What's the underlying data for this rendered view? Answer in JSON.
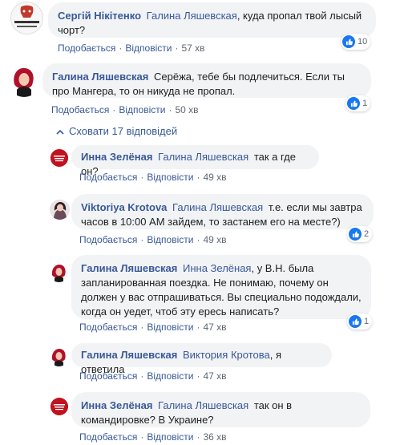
{
  "actions": {
    "like": "Подобається",
    "reply": "Відповісти",
    "separator": "·"
  },
  "comments": [
    {
      "author": "Сергій Нікітенко",
      "mention": "Галина Ляшевская",
      "text": ", куда пропал твой лысый чорт?",
      "time": "57 хв",
      "likes": "10",
      "avatar_label": "ХУЛІ ЗАБИВАТИ ХУЙ"
    },
    {
      "author": "Галина Ляшевская",
      "text": "Серёжа, тебе бы подлечиться. Если ты про Мангера, то он никуда не пропал.",
      "time": "50 хв",
      "likes": "1"
    }
  ],
  "replies_toggle": "Сховати 17 відповідей",
  "replies": [
    {
      "author": "Инна Зелёная",
      "mention": "Галина Ляшевская",
      "text": "так а где он?",
      "time": "49 хв"
    },
    {
      "author": "Viktoriya Krotova",
      "mention": "Галина Ляшевская",
      "text": "т.е. если мы завтра часов в 10:00 AM зайдем, то застанем его на месте?)",
      "time": "49 хв",
      "likes": "2"
    },
    {
      "author": "Галина Ляшевская",
      "mention": "Инна Зелёная",
      "text": ", у В.Н. была запланированная поездка. Не понимаю, почему он должен у вас отпрашиваться. Вы специально подождали, когда он уедет, чтоб эту ересь написать?",
      "time": "47 хв",
      "likes": "1"
    },
    {
      "author": "Галина Ляшевская",
      "mention": "Виктория Кротова",
      "text": ", я ответила",
      "time": "47 хв"
    },
    {
      "author": "Инна Зелёная",
      "mention": "Галина Ляшевская",
      "text": "так он в командировке? В Украине?",
      "time": "36 хв"
    }
  ],
  "colors": {
    "link": "#385898",
    "bubble": "#f2f3f5",
    "like_blue": "#1877f2",
    "meta": "#606770"
  },
  "icons": {
    "like": "thumbs-up-icon",
    "toggle": "chevron-up-icon"
  }
}
